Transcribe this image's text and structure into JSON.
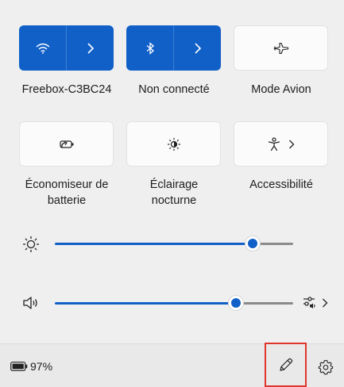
{
  "tiles": {
    "wifi": {
      "label": "Freebox-C3BC24",
      "icon": "wifi-icon",
      "state": "on"
    },
    "bluetooth": {
      "label": "Non connecté",
      "icon": "bluetooth-icon",
      "state": "on"
    },
    "airplane": {
      "label": "Mode Avion",
      "icon": "airplane-icon",
      "state": "off"
    },
    "battery_saver": {
      "label_line1": "Économiseur de",
      "label_line2": "batterie",
      "icon": "battery-saver-icon",
      "state": "off"
    },
    "night_light": {
      "label_line1": "Éclairage",
      "label_line2": "nocturne",
      "icon": "night-light-icon",
      "state": "off"
    },
    "accessibility": {
      "label": "Accessibilité",
      "icon": "accessibility-icon",
      "state": "off"
    }
  },
  "sliders": {
    "brightness": {
      "icon": "brightness-icon",
      "level": 0.83
    },
    "volume": {
      "icon": "speaker-icon",
      "level": 0.76
    }
  },
  "footer": {
    "battery_percent": "97%",
    "battery_icon": "battery-icon",
    "edit_icon": "pencil-icon",
    "settings_icon": "gear-icon"
  },
  "colors": {
    "accent": "#1060c8",
    "highlight_border": "#e0352b"
  }
}
